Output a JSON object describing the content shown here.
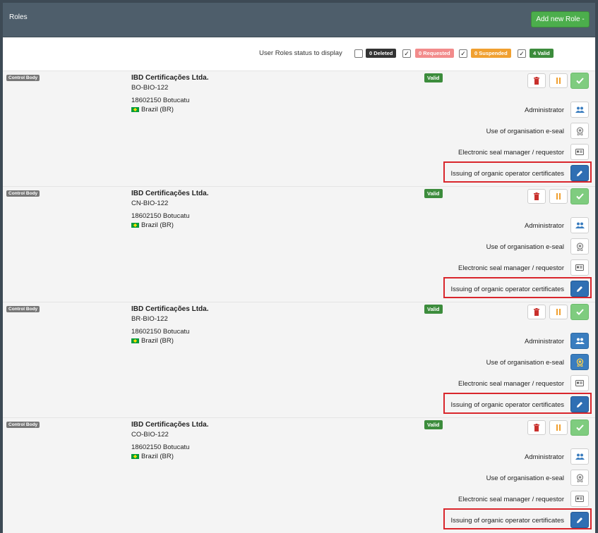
{
  "header": {
    "title": "Roles",
    "add_button": "Add new Role -"
  },
  "filter": {
    "label": "User Roles status to display",
    "options": [
      {
        "label": "0 Deleted",
        "checked": false,
        "color": "#333333"
      },
      {
        "label": "0 Requested",
        "checked": true,
        "color": "#f28b8b"
      },
      {
        "label": "0 Suspended",
        "checked": true,
        "color": "#f0a030"
      },
      {
        "label": "4 Valid",
        "checked": true,
        "color": "#3c8c3c"
      }
    ]
  },
  "roles": [
    {
      "type": "Control Body",
      "name": "IBD Certificações Ltda.",
      "code": "BO-BIO-122",
      "address": "18602150 Botucatu",
      "country": "Brazil (BR)",
      "status": "Valid",
      "eseal_active": false
    },
    {
      "type": "Control Body",
      "name": "IBD Certificações Ltda.",
      "code": "CN-BIO-122",
      "address": "18602150 Botucatu",
      "country": "Brazil (BR)",
      "status": "Valid",
      "eseal_active": false
    },
    {
      "type": "Control Body",
      "name": "IBD Certificações Ltda.",
      "code": "BR-BIO-122",
      "address": "18602150 Botucatu",
      "country": "Brazil (BR)",
      "status": "Valid",
      "eseal_active": true
    },
    {
      "type": "Control Body",
      "name": "IBD Certificações Ltda.",
      "code": "CO-BIO-122",
      "address": "18602150 Botucatu",
      "country": "Brazil (BR)",
      "status": "Valid",
      "eseal_active": false
    }
  ],
  "permissions": {
    "administrator": "Administrator",
    "eseal_use": "Use of organisation e-seal",
    "eseal_manager": "Electronic seal manager / requestor",
    "issuing": "Issuing of organic operator certificates"
  },
  "icons": {
    "delete": "trash-icon",
    "suspend": "pause-icon",
    "validate": "check-icon",
    "administrator": "users-icon",
    "eseal_use": "seal-icon",
    "eseal_manager": "id-card-icon",
    "issuing": "pencil-icon"
  },
  "colors": {
    "highlight": "#d9262c",
    "primary": "#3a7dbf",
    "success": "#4cae4c"
  }
}
